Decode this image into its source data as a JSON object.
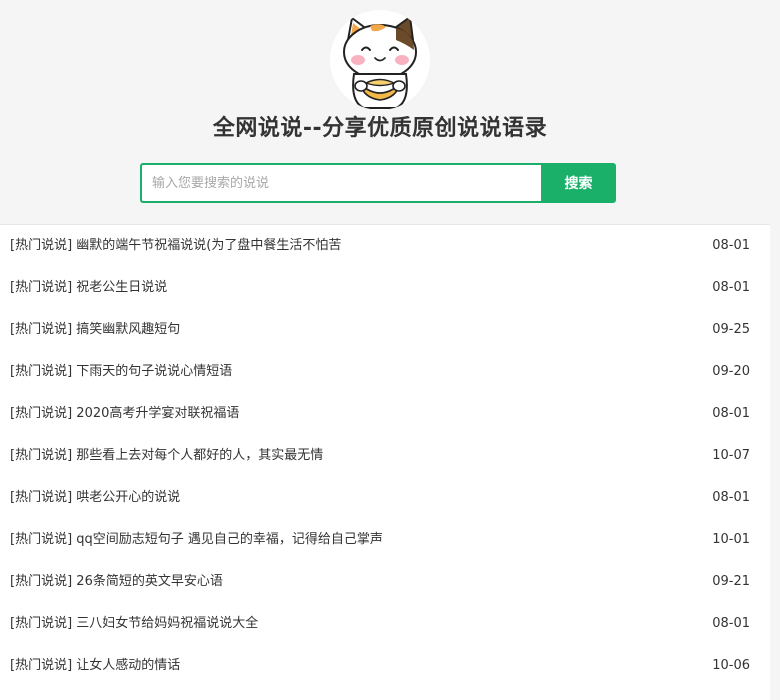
{
  "site": {
    "title": "全网说说--分享优质原创说说语录",
    "logo_icon": "cat-mascot-icon"
  },
  "search": {
    "placeholder": "输入您要搜索的说说",
    "value": "",
    "button_label": "搜索"
  },
  "colors": {
    "accent": "#1ab06a",
    "page_background": "#f5f5f5",
    "list_background": "#ffffff",
    "text": "#333333"
  },
  "list": {
    "items": [
      {
        "category": "[热门说说]",
        "title": "幽默的端午节祝福说说(为了盘中餐生活不怕苦",
        "date": "08-01"
      },
      {
        "category": "[热门说说]",
        "title": "祝老公生日说说",
        "date": "08-01"
      },
      {
        "category": "[热门说说]",
        "title": "搞笑幽默风趣短句",
        "date": "09-25"
      },
      {
        "category": "[热门说说]",
        "title": "下雨天的句子说说心情短语",
        "date": "09-20"
      },
      {
        "category": "[热门说说]",
        "title": "2020高考升学宴对联祝福语",
        "date": "08-01"
      },
      {
        "category": "[热门说说]",
        "title": "那些看上去对每个人都好的人，其实最无情",
        "date": "10-07"
      },
      {
        "category": "[热门说说]",
        "title": "哄老公开心的说说",
        "date": "08-01"
      },
      {
        "category": "[热门说说]",
        "title": "qq空间励志短句子 遇见自己的幸福，记得给自己掌声",
        "date": "10-01"
      },
      {
        "category": "[热门说说]",
        "title": "26条简短的英文早安心语",
        "date": "09-21"
      },
      {
        "category": "[热门说说]",
        "title": "三八妇女节给妈妈祝福说说大全",
        "date": "08-01"
      },
      {
        "category": "[热门说说]",
        "title": "让女人感动的情话",
        "date": "10-06"
      }
    ]
  }
}
